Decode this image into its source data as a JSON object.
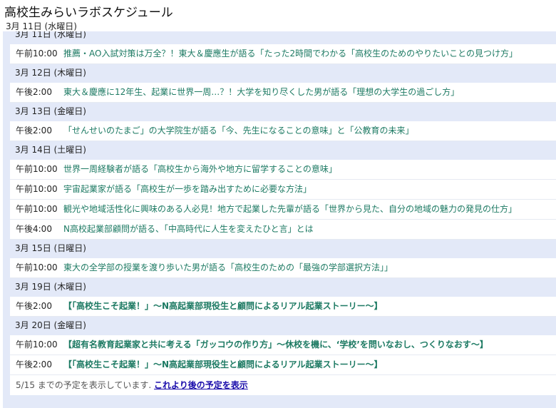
{
  "header": {
    "title": "高校生みらいラボスケジュール",
    "current_date": "3月 11日 (水曜日)"
  },
  "days": [
    {
      "date": "3月 11日 (水曜日)",
      "events": [
        {
          "time": "午前10:00",
          "title": "推薦・AO入試対策は万全？！東大＆慶應生が語る「たった2時間でわかる「高校生のためのやりたいことの見つけ方」",
          "bold": false
        }
      ]
    },
    {
      "date": "3月 12日 (木曜日)",
      "events": [
        {
          "time": "午後2:00",
          "title": "東大＆慶應に12年生、起業に世界一周…？！大学を知り尽くした男が語る「理想の大学生の過ごし方」",
          "bold": false
        }
      ]
    },
    {
      "date": "3月 13日 (金曜日)",
      "events": [
        {
          "time": "午後2:00",
          "title": "「せんせいのたまご」の大学院生が語る「今、先生になることの意味」と「公教育の未来」",
          "bold": false
        }
      ]
    },
    {
      "date": "3月 14日 (土曜日)",
      "events": [
        {
          "time": "午前10:00",
          "title": "世界一周経験者が語る「高校生から海外や地方に留学することの意味」",
          "bold": false
        },
        {
          "time": "午前10:00",
          "title": "宇宙起業家が語る「高校生が一歩を踏み出すために必要な方法」",
          "bold": false
        },
        {
          "time": "午前10:00",
          "title": "観光や地域活性化に興味のある人必見！地方で起業した先輩が語る「世界から見た、自分の地域の魅力の発見の仕方」",
          "bold": false
        },
        {
          "time": "午後4:00",
          "title": "N高校起業部顧問が語る、「中高時代に人生を変えたひと言」とは",
          "bold": false
        }
      ]
    },
    {
      "date": "3月 15日 (日曜日)",
      "events": [
        {
          "time": "午前10:00",
          "title": "東大の全学部の授業を渡り歩いた男が語る「高校生のための「最強の学部選択方法」」",
          "bold": false
        }
      ]
    },
    {
      "date": "3月 19日 (木曜日)",
      "events": [
        {
          "time": "午後2:00",
          "title": "【「高校生こそ起業！」〜N高起業部現役生と顧問によるリアル起業ストーリー〜】",
          "bold": true
        }
      ]
    },
    {
      "date": "3月 20日 (金曜日)",
      "events": [
        {
          "time": "午前10:00",
          "title": "【超有名教育起業家と共に考える「ガッコウの作り方」〜休校を機に、‘学校’を問いなおし、つくりなおす〜】",
          "bold": true
        },
        {
          "time": "午後2:00",
          "title": "【「高校生こそ起業！」〜N高起業部現役生と顧問によるリアル起業ストーリー〜】",
          "bold": true
        }
      ]
    }
  ],
  "footer": {
    "text": "5/15 までの予定を表示しています.",
    "link": "これより後の予定を表示"
  }
}
